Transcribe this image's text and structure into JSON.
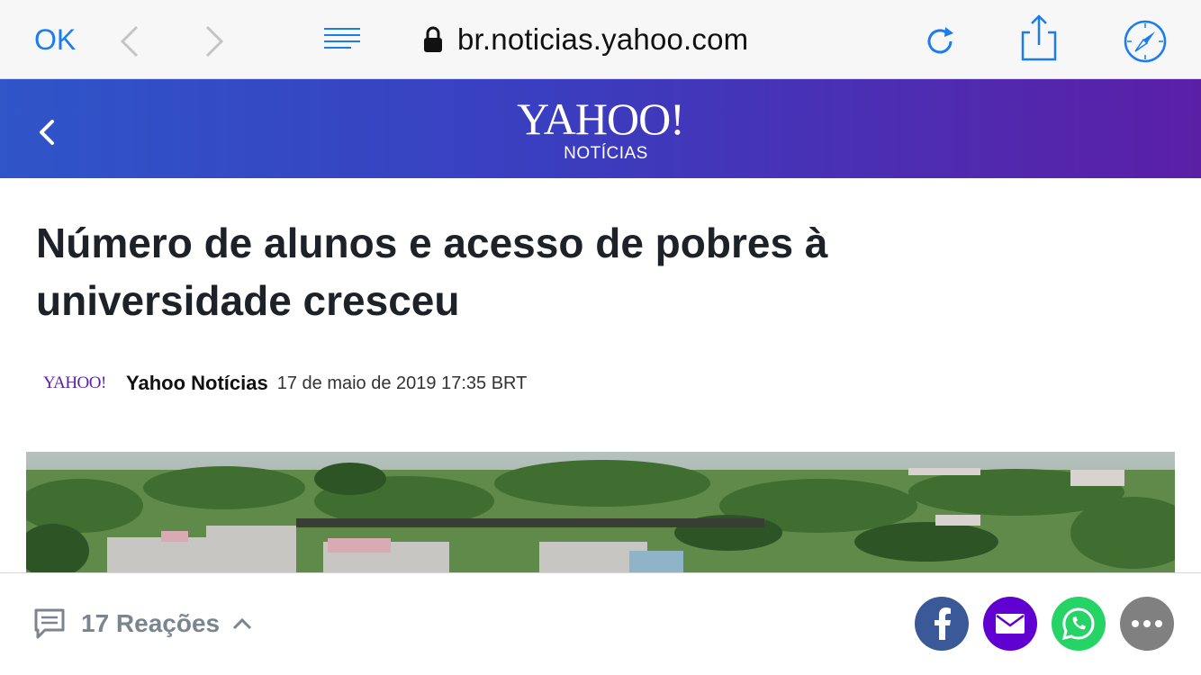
{
  "browser": {
    "done_label": "OK",
    "url": "br.noticias.yahoo.com",
    "icons": {
      "back": "chevron-left-icon",
      "forward": "chevron-right-icon",
      "reader": "reader-mode-icon",
      "lock": "lock-icon",
      "reload": "reload-icon",
      "share": "share-icon",
      "open_in_safari": "compass-icon"
    },
    "accent": "#1a7cf0"
  },
  "header": {
    "logo": "YAHOO!",
    "section": "NOTÍCIAS",
    "back_icon": "chevron-left-icon",
    "gradient": [
      "#2f55c9",
      "#5b1fa6"
    ]
  },
  "article": {
    "headline": "Número de alunos e acesso de pobres à universidade cresceu",
    "source_logo": "YAHOO!",
    "author": "Yahoo Notícias",
    "date": "17 de maio de 2019 17:35 BRT"
  },
  "bottom": {
    "reactions_label": "17 Reações",
    "reactions_icon": "comment-icon",
    "expand_icon": "chevron-up-icon",
    "share_buttons": [
      {
        "name": "facebook",
        "color": "#3b5998"
      },
      {
        "name": "email",
        "color": "#6001d2"
      },
      {
        "name": "whatsapp",
        "color": "#25d366"
      },
      {
        "name": "more",
        "color": "#808080"
      }
    ]
  }
}
